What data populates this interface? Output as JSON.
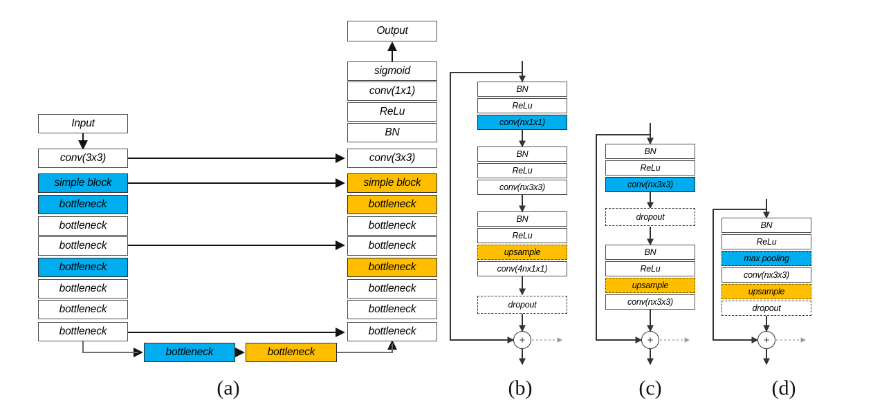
{
  "figure": {
    "type": "neural-network-architecture-diagram",
    "panels": [
      {
        "id": "a",
        "caption": "(a)"
      },
      {
        "id": "b",
        "caption": "(b)"
      },
      {
        "id": "c",
        "caption": "(c)"
      },
      {
        "id": "d",
        "caption": "(d)"
      }
    ]
  },
  "colors": {
    "blue": "#00AEEF",
    "orange": "#FFBF00",
    "white": "#FFFFFF",
    "stroke": "#4D4D4D",
    "wire": "#1A1A1A"
  },
  "panel_a": {
    "encoder": [
      {
        "label": "Input",
        "fill": "white"
      },
      {
        "label": "conv(3x3)",
        "fill": "white"
      },
      {
        "label": "simple block",
        "fill": "blue"
      },
      {
        "label": "bottleneck",
        "fill": "blue"
      },
      {
        "label": "bottleneck",
        "fill": "white"
      },
      {
        "label": "bottleneck",
        "fill": "white"
      },
      {
        "label": "bottleneck",
        "fill": "blue"
      },
      {
        "label": "bottleneck",
        "fill": "white"
      },
      {
        "label": "bottleneck",
        "fill": "white"
      },
      {
        "label": "bottleneck",
        "fill": "white"
      }
    ],
    "decoder": [
      {
        "label": "Output",
        "fill": "white"
      },
      {
        "label": "sigmoid",
        "fill": "white"
      },
      {
        "label": "conv(1x1)",
        "fill": "white"
      },
      {
        "label": "ReLu",
        "fill": "white"
      },
      {
        "label": "BN",
        "fill": "white"
      },
      {
        "label": "conv(3x3)",
        "fill": "white"
      },
      {
        "label": "simple block",
        "fill": "orange"
      },
      {
        "label": "bottleneck",
        "fill": "orange"
      },
      {
        "label": "bottleneck",
        "fill": "white"
      },
      {
        "label": "bottleneck",
        "fill": "white"
      },
      {
        "label": "bottleneck",
        "fill": "orange"
      },
      {
        "label": "bottleneck",
        "fill": "white"
      },
      {
        "label": "bottleneck",
        "fill": "white"
      },
      {
        "label": "bottleneck",
        "fill": "white"
      }
    ],
    "bridge": [
      {
        "label": "bottleneck",
        "fill": "blue"
      },
      {
        "label": "bottleneck",
        "fill": "orange"
      }
    ]
  },
  "panel_b": {
    "blocks": [
      {
        "label": "BN",
        "fill": "white",
        "dashed": false
      },
      {
        "label": "ReLu",
        "fill": "white",
        "dashed": false
      },
      {
        "label": "conv(nx1x1)",
        "fill": "blue",
        "dashed": false
      },
      {
        "label": "BN",
        "fill": "white",
        "dashed": false
      },
      {
        "label": "ReLu",
        "fill": "white",
        "dashed": false
      },
      {
        "label": "conv(nx3x3)",
        "fill": "white",
        "dashed": false
      },
      {
        "label": "BN",
        "fill": "white",
        "dashed": false
      },
      {
        "label": "ReLu",
        "fill": "white",
        "dashed": false
      },
      {
        "label": "upsample",
        "fill": "orange",
        "dashed": true
      },
      {
        "label": "conv(4nx1x1)",
        "fill": "white",
        "dashed": false
      },
      {
        "label": "dropout",
        "fill": "white",
        "dashed": true
      }
    ],
    "merge_symbol": "+"
  },
  "panel_c": {
    "blocks": [
      {
        "label": "BN",
        "fill": "white",
        "dashed": false
      },
      {
        "label": "ReLu",
        "fill": "white",
        "dashed": false
      },
      {
        "label": "conv(nx3x3)",
        "fill": "blue",
        "dashed": false
      },
      {
        "label": "dropout",
        "fill": "white",
        "dashed": true
      },
      {
        "label": "BN",
        "fill": "white",
        "dashed": false
      },
      {
        "label": "ReLu",
        "fill": "white",
        "dashed": false
      },
      {
        "label": "upsample",
        "fill": "orange",
        "dashed": true
      },
      {
        "label": "conv(nx3x3)",
        "fill": "white",
        "dashed": false
      }
    ],
    "merge_symbol": "+"
  },
  "panel_d": {
    "blocks": [
      {
        "label": "BN",
        "fill": "white",
        "dashed": false
      },
      {
        "label": "ReLu",
        "fill": "white",
        "dashed": false
      },
      {
        "label": "max pooling",
        "fill": "blue",
        "dashed": true
      },
      {
        "label": "conv(nx3x3)",
        "fill": "white",
        "dashed": false
      },
      {
        "label": "upsample",
        "fill": "orange",
        "dashed": true
      },
      {
        "label": "dropout",
        "fill": "white",
        "dashed": true
      }
    ],
    "merge_symbol": "+"
  }
}
